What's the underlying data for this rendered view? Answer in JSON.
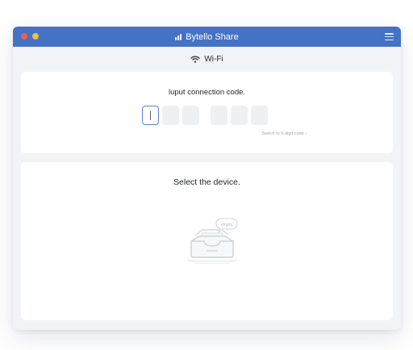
{
  "window": {
    "title": "Bytello Share",
    "titlebar_color": "#4472c4",
    "traffic_lights": [
      "#f25b5b",
      "#f5c033"
    ]
  },
  "network": {
    "icon": "wifi-icon",
    "label": "Wi-Fi"
  },
  "connection_code": {
    "heading": "luput connection code.",
    "boxes": [
      "",
      "",
      "",
      "",
      "",
      ""
    ],
    "switch_link": "Switch to 6-digit code ›",
    "active_box_border": "#5b82d4"
  },
  "device_select": {
    "heading": "Select the device.",
    "empty_badge": "empty",
    "empty_icon": "empty-inbox-icon"
  }
}
